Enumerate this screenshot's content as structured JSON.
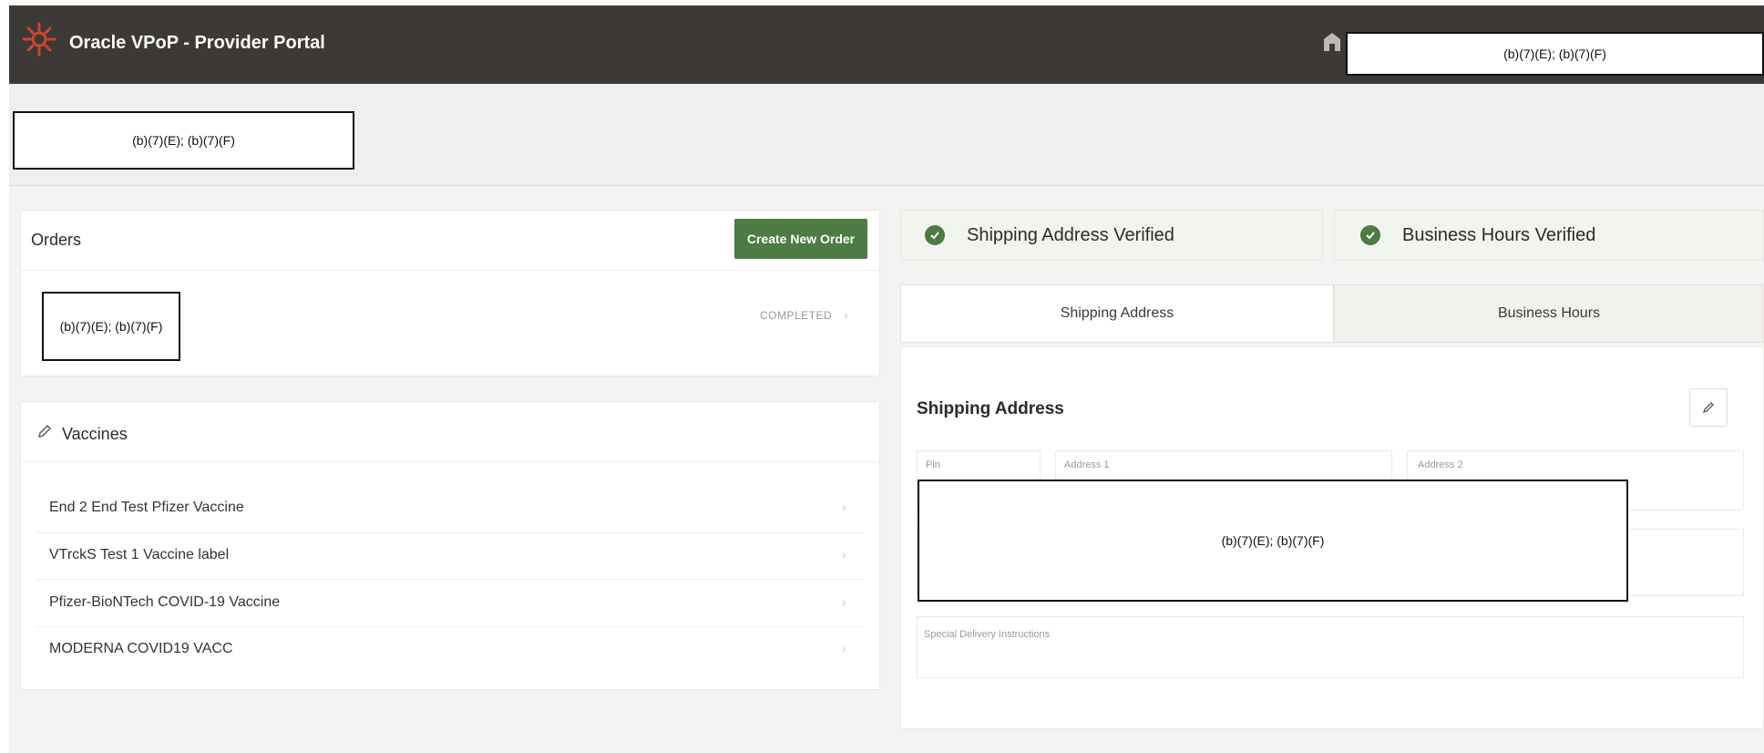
{
  "header": {
    "title": "Oracle VPoP - Provider Portal",
    "redacted_text": "(b)(7)(E); (b)(7)(F)"
  },
  "subheader": {
    "redacted_text": "(b)(7)(E); (b)(7)(F)"
  },
  "orders": {
    "title": "Orders",
    "create_button": "Create New Order",
    "rows": [
      {
        "redacted_text": "(b)(7)(E); (b)(7)(F)",
        "status": "COMPLETED"
      }
    ]
  },
  "vaccines": {
    "title": "Vaccines",
    "items": [
      {
        "label": "End 2 End Test Pfizer Vaccine"
      },
      {
        "label": "VTrckS Test 1 Vaccine label"
      },
      {
        "label": "Pfizer-BioNTech COVID-19 Vaccine"
      },
      {
        "label": "MODERNA COVID19 VACC"
      }
    ]
  },
  "verification": {
    "shipping": "Shipping Address Verified",
    "business": "Business Hours Verified"
  },
  "tabs": [
    {
      "label": "Shipping Address"
    },
    {
      "label": "Business Hours"
    }
  ],
  "shipping_panel": {
    "title": "Shipping Address",
    "fields": {
      "pin": "Pin",
      "address1": "Address 1",
      "address2": "Address 2",
      "instructions": "Special Delivery Instructions"
    },
    "redacted_text": "(b)(7)(E); (b)(7)(F)"
  },
  "icons": {
    "logo": "oracle-sun-logo",
    "home": "home-icon",
    "edit": "pencil-icon",
    "check": "check-circle-icon",
    "chevron": "chevron-right-icon"
  },
  "colors": {
    "header": "#3d3936",
    "accent_green": "#4e7a44",
    "verified_bg": "#f1f4ef"
  }
}
